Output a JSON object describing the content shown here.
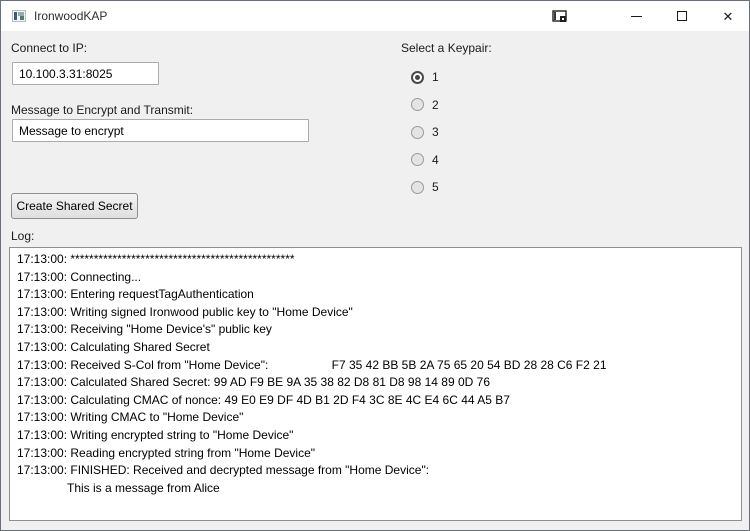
{
  "window": {
    "title": "IronwoodKAP",
    "controls": {
      "minimize": "minimize",
      "maximize": "maximize",
      "close": "close",
      "close_glyph": "✕"
    }
  },
  "form": {
    "ip_label": "Connect to IP:",
    "ip_value": "10.100.3.31:8025",
    "message_label": "Message to Encrypt and Transmit:",
    "message_value": "Message to encrypt",
    "keypair_label": "Select a Keypair:",
    "keypair_options": [
      {
        "label": "1",
        "selected": true
      },
      {
        "label": "2",
        "selected": false
      },
      {
        "label": "3",
        "selected": false
      },
      {
        "label": "4",
        "selected": false
      },
      {
        "label": "5",
        "selected": false
      }
    ],
    "create_button_label": "Create Shared Secret",
    "log_label": "Log:"
  },
  "log": {
    "lines": [
      "17:13:00: ************************************************",
      "17:13:00: Connecting...",
      "17:13:00: Entering requestTagAuthentication",
      "17:13:00: Writing signed Ironwood public key to \"Home Device\"",
      "17:13:00: Receiving \"Home Device's\" public key",
      "17:13:00: Calculating Shared Secret",
      "17:13:00: Received S-Col from \"Home Device\":                   F7 35 42 BB 5B 2A 75 65 20 54 BD 28 28 C6 F2 21",
      "17:13:00: Calculated Shared Secret: 99 AD F9 BE 9A 35 38 82 D8 81 D8 98 14 89 0D 76",
      "17:13:00: Calculating CMAC of nonce: 49 E0 E9 DF 4D B1 2D F4 3C 8E 4C E4 6C 44 A5 B7",
      "17:13:00: Writing CMAC to \"Home Device\"",
      "17:13:00: Writing encrypted string to \"Home Device\"",
      "17:13:00: Reading encrypted string from \"Home Device\"",
      "17:13:00: FINISHED: Received and decrypted message from \"Home Device\":",
      "               This is a message from Alice"
    ]
  }
}
